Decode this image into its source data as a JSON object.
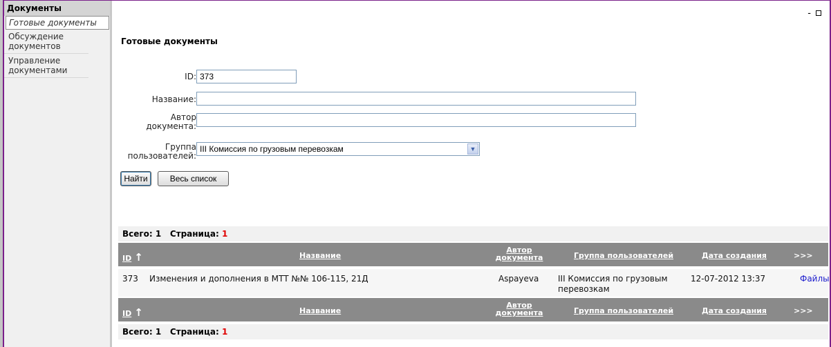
{
  "sidebar": {
    "title": "Документы",
    "items": [
      {
        "label": "Готовые документы"
      },
      {
        "label": "Обсуждение документов"
      },
      {
        "label": "Управление документами"
      }
    ]
  },
  "window": {
    "minimize": "-",
    "maximize": ""
  },
  "page": {
    "title": "Готовые документы"
  },
  "form": {
    "id_label": "ID:",
    "id_value": "373",
    "name_label": "Название:",
    "name_value": "",
    "author_label": "Автор документа:",
    "author_value": "",
    "group_label": "Группа пользователей:",
    "group_value": "III Комиссия по грузовым перевозкам",
    "find_button": "Найти",
    "all_button": "Весь список"
  },
  "summary": {
    "total_label": "Всего:",
    "total_value": "1",
    "page_label": "Страница:",
    "page_value": "1"
  },
  "table": {
    "headers": {
      "id": "ID",
      "name": "Название",
      "author": "Автор документа",
      "group": "Группа пользователей",
      "date": "Дата создания",
      "more": ">>>"
    },
    "rows": [
      {
        "id": "373",
        "name": "Изменения и дополнения в МТТ №№ 106-115, 21Д",
        "author": "Aspayeva",
        "group": "III Комиссия по грузовым перевозкам",
        "date": "12-07-2012 13:37",
        "files": "Файлы"
      }
    ]
  }
}
